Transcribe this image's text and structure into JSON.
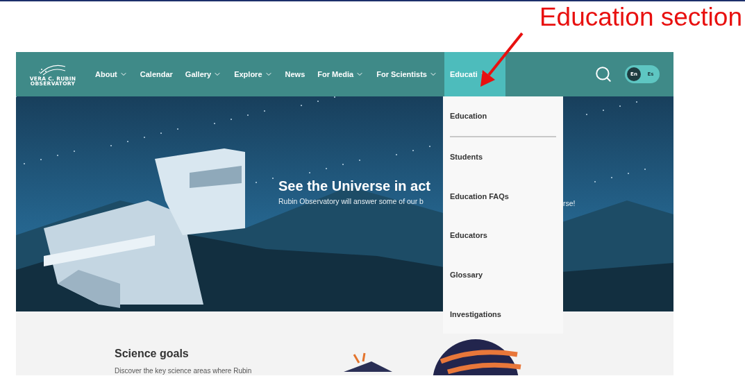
{
  "annotation": {
    "label": "Education section"
  },
  "nav": {
    "logo": {
      "line_1": "VERA C. RUBIN",
      "line_2": "OBSERVATORY"
    },
    "items": [
      {
        "label": "About",
        "dropdown": true,
        "selected": false
      },
      {
        "label": "Calendar",
        "dropdown": false,
        "selected": false
      },
      {
        "label": "Gallery",
        "dropdown": true,
        "selected": false
      },
      {
        "label": "Explore",
        "dropdown": true,
        "selected": false
      },
      {
        "label": "News",
        "dropdown": false,
        "selected": false
      },
      {
        "label": "For Media",
        "dropdown": true,
        "selected": false
      },
      {
        "label": "For Scientists",
        "dropdown": true,
        "selected": false
      },
      {
        "label": "Educati",
        "dropdown": true,
        "selected": true
      }
    ],
    "language": [
      {
        "label": "En",
        "selected": true
      },
      {
        "label": "Es",
        "selected": false
      }
    ]
  },
  "dropdown": {
    "items": [
      {
        "label": "Education",
        "kind": "heading"
      },
      {
        "label": "Students",
        "kind": "link"
      },
      {
        "label": "Education FAQs",
        "kind": "link"
      },
      {
        "label": "Educators",
        "kind": "link"
      },
      {
        "label": "Glossary",
        "kind": "link"
      },
      {
        "label": "Investigations",
        "kind": "link"
      }
    ]
  },
  "hero": {
    "title": "See the Universe in act",
    "subtitle": "Rubin Observatory will answer some of our b",
    "subtitle_tail": "rse!"
  },
  "section": {
    "title": "Science goals",
    "text": "Discover the key science areas where Rubin"
  }
}
